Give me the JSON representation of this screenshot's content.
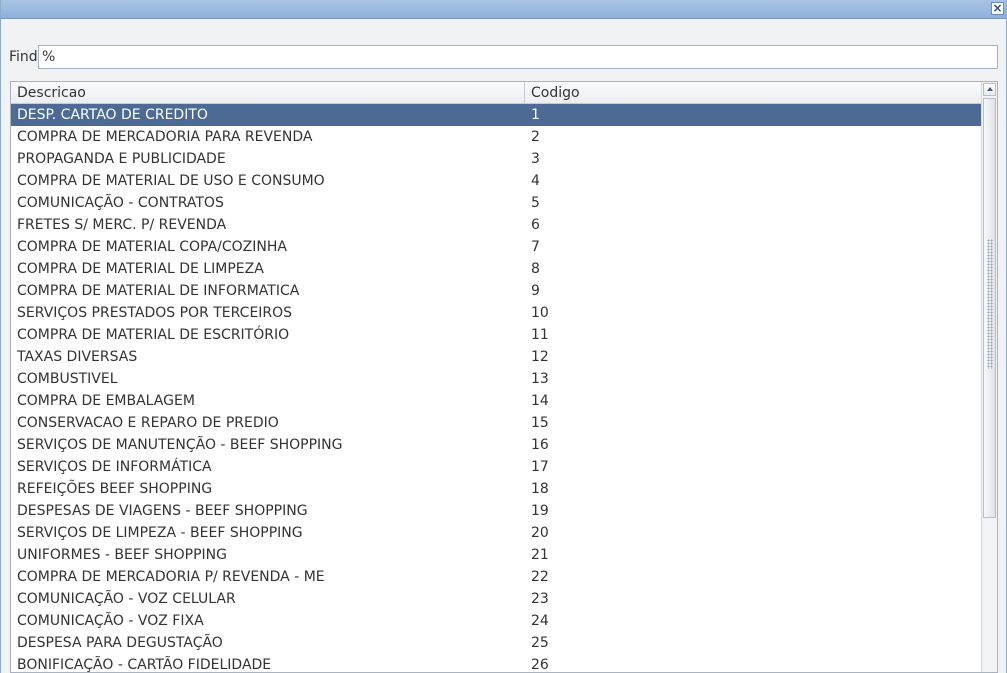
{
  "window": {
    "close_symbol": "×"
  },
  "find": {
    "label": "Find",
    "value": "%"
  },
  "table": {
    "headers": {
      "descricao": "Descricao",
      "codigo": "Codigo"
    },
    "rows": [
      {
        "descricao": "DESP. CARTAO DE CREDITO",
        "codigo": "1"
      },
      {
        "descricao": "COMPRA DE MERCADORIA PARA REVENDA",
        "codigo": "2"
      },
      {
        "descricao": "PROPAGANDA E PUBLICIDADE",
        "codigo": "3"
      },
      {
        "descricao": "COMPRA DE MATERIAL DE USO E CONSUMO",
        "codigo": "4"
      },
      {
        "descricao": "COMUNICAÇÃO - CONTRATOS",
        "codigo": "5"
      },
      {
        "descricao": "FRETES S/ MERC. P/ REVENDA",
        "codigo": "6"
      },
      {
        "descricao": "COMPRA DE MATERIAL COPA/COZINHA",
        "codigo": "7"
      },
      {
        "descricao": "COMPRA DE MATERIAL DE LIMPEZA",
        "codigo": "8"
      },
      {
        "descricao": "COMPRA DE MATERIAL DE INFORMATICA",
        "codigo": "9"
      },
      {
        "descricao": "SERVIÇOS PRESTADOS POR TERCEIROS",
        "codigo": "10"
      },
      {
        "descricao": "COMPRA DE MATERIAL DE ESCRITÓRIO",
        "codigo": "11"
      },
      {
        "descricao": "TAXAS DIVERSAS",
        "codigo": "12"
      },
      {
        "descricao": "COMBUSTIVEL",
        "codigo": "13"
      },
      {
        "descricao": "COMPRA DE EMBALAGEM",
        "codigo": "14"
      },
      {
        "descricao": "CONSERVACAO E REPARO DE PREDIO",
        "codigo": "15"
      },
      {
        "descricao": "SERVIÇOS DE MANUTENÇÃO - BEEF SHOPPING",
        "codigo": "16"
      },
      {
        "descricao": "SERVIÇOS DE INFORMÁTICA",
        "codigo": "17"
      },
      {
        "descricao": "REFEIÇÕES BEEF SHOPPING",
        "codigo": "18"
      },
      {
        "descricao": "DESPESAS DE VIAGENS - BEEF SHOPPING",
        "codigo": "19"
      },
      {
        "descricao": "SERVIÇOS DE LIMPEZA - BEEF SHOPPING",
        "codigo": "20"
      },
      {
        "descricao": "UNIFORMES - BEEF SHOPPING",
        "codigo": "21"
      },
      {
        "descricao": "COMPRA DE MERCADORIA P/ REVENDA - ME",
        "codigo": "22"
      },
      {
        "descricao": "COMUNICAÇÃO - VOZ CELULAR",
        "codigo": "23"
      },
      {
        "descricao": "COMUNICAÇÃO - VOZ FIXA",
        "codigo": "24"
      },
      {
        "descricao": "DESPESA PARA DEGUSTAÇÃO",
        "codigo": "25"
      },
      {
        "descricao": "BONIFICAÇÃO - CARTÃO FIDELIDADE",
        "codigo": "26"
      }
    ],
    "selected_index": 0
  },
  "colors": {
    "titlebar": "#8db0da",
    "selected_row": "#4c6a93",
    "selected_text": "#ffffff"
  },
  "icons": {
    "close": "close-icon",
    "scroll_up": "scroll-up-arrow-icon"
  }
}
